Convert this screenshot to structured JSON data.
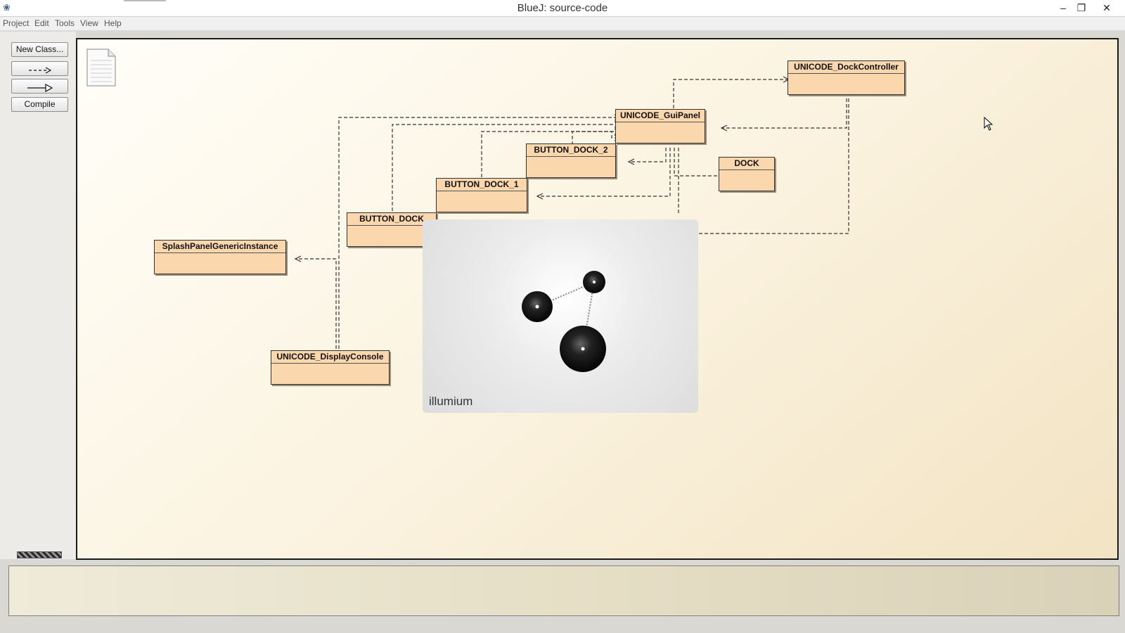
{
  "window": {
    "title": "BlueJ:  source-code",
    "app_icon": "bluej-icon",
    "controls": {
      "minimize": "–",
      "restore": "❐",
      "close": "✕"
    }
  },
  "menu": {
    "items": [
      "Project",
      "Edit",
      "Tools",
      "View",
      "Help"
    ]
  },
  "toolbar": {
    "new_class_label": "New Class...",
    "uses_arrow_icon": "dashed-arrow-icon",
    "inherit_arrow_icon": "solid-arrow-icon",
    "compile_label": "Compile"
  },
  "diagram": {
    "readme_icon": "document-icon",
    "classes": {
      "dock_controller": "UNICODE_DockController",
      "gui_panel": "UNICODE_GuiPanel",
      "button_dock_2": "BUTTON_DOCK_2",
      "dock": "DOCK",
      "button_dock_1": "BUTTON_DOCK_1",
      "button_dock": "BUTTON_DOCK",
      "splash_panel": "SplashPanelGenericInstance",
      "display_console": "UNICODE_DisplayConsole"
    }
  },
  "splash": {
    "label": "illumium"
  },
  "colors": {
    "class_fill": "#fbd7ae",
    "canvas_bg": "#fbf3e0",
    "terminal_bg": "#e6dfc6"
  }
}
